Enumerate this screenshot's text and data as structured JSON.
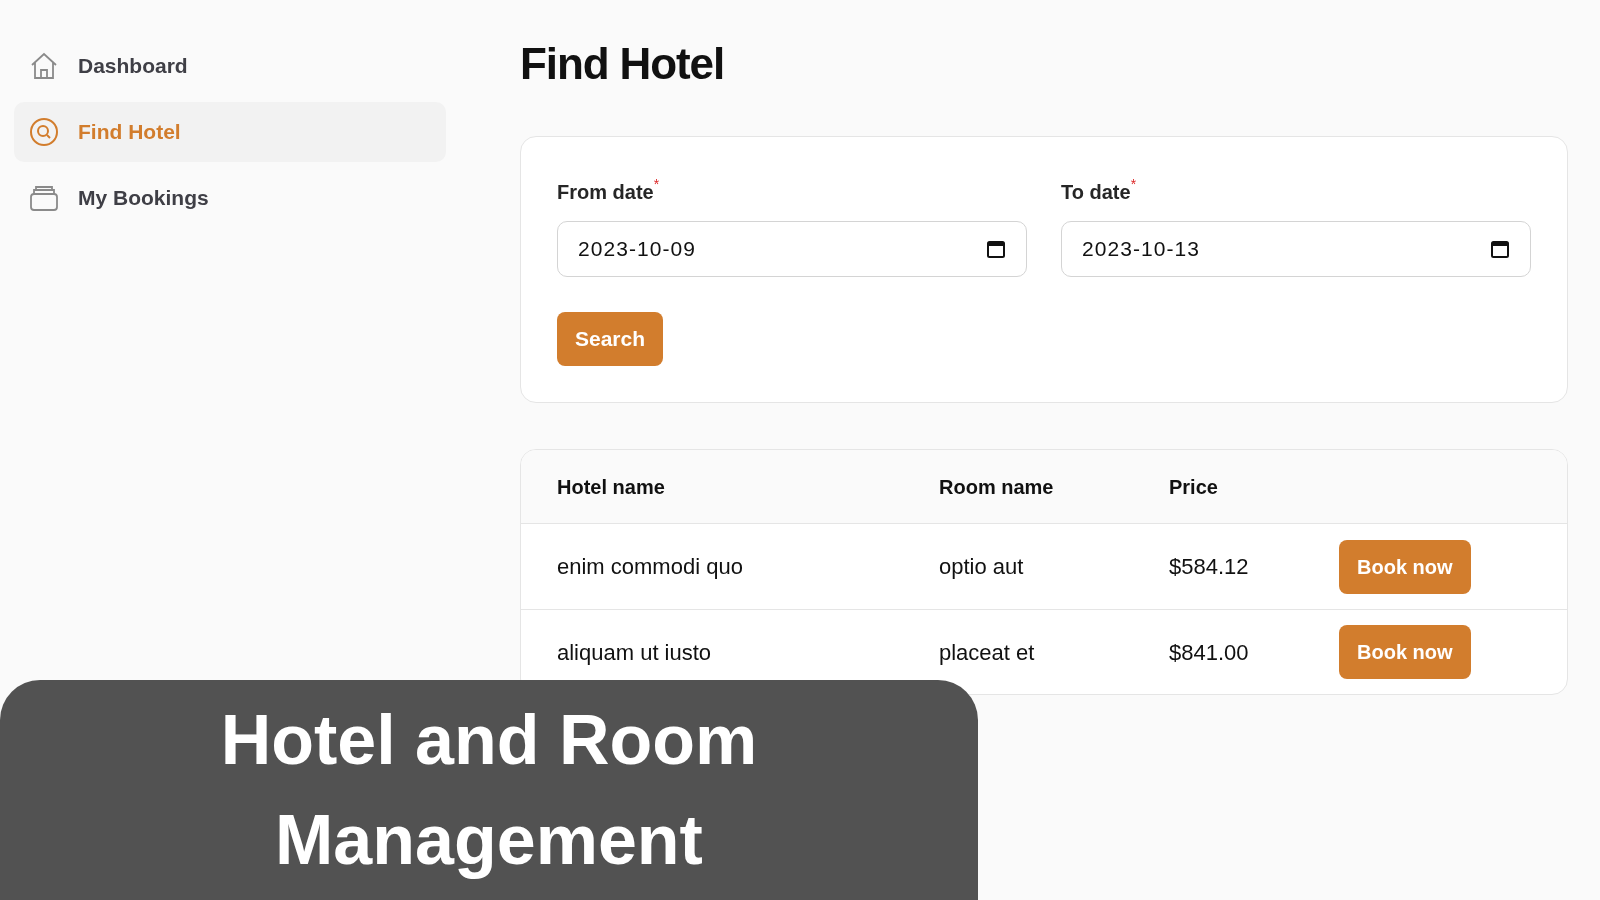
{
  "sidebar": {
    "items": [
      {
        "label": "Dashboard",
        "kind": "home",
        "selected": false
      },
      {
        "label": "Find Hotel",
        "kind": "search",
        "selected": true
      },
      {
        "label": "My Bookings",
        "kind": "box",
        "selected": false
      }
    ]
  },
  "page_title": "Find Hotel",
  "form": {
    "fields": [
      {
        "label": "From date",
        "required_mark": "*",
        "value": "2023-10-09"
      },
      {
        "label": "To date",
        "required_mark": "*",
        "value": "2023-10-13"
      }
    ],
    "submit": "Search"
  },
  "table": {
    "columns": [
      "Hotel name",
      "Room name",
      "Price"
    ],
    "rows": [
      {
        "hotel": "enim commodi quo",
        "room": "optio aut",
        "price": "$584.12",
        "action": "Book now"
      },
      {
        "hotel": "aliquam ut iusto",
        "room": "placeat et",
        "price": "$841.00",
        "action": "Book now"
      }
    ]
  },
  "banner": {
    "lines": [
      "Hotel and Room",
      "Management"
    ]
  }
}
